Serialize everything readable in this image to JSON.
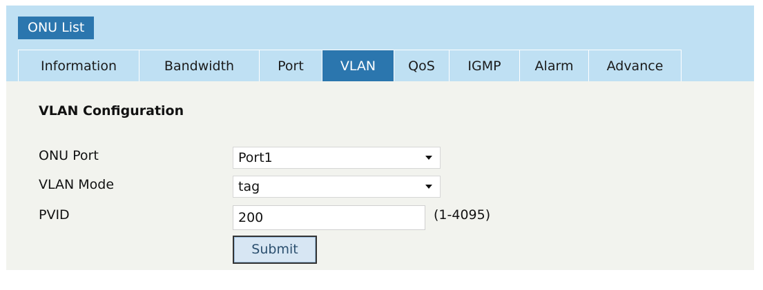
{
  "header": {
    "section_tab_label": "ONU List"
  },
  "tabs": [
    {
      "label": "Information",
      "active": false
    },
    {
      "label": "Bandwidth",
      "active": false
    },
    {
      "label": "Port",
      "active": false
    },
    {
      "label": "VLAN",
      "active": true
    },
    {
      "label": "QoS",
      "active": false
    },
    {
      "label": "IGMP",
      "active": false
    },
    {
      "label": "Alarm",
      "active": false
    },
    {
      "label": "Advance",
      "active": false
    }
  ],
  "form": {
    "title": "VLAN Configuration",
    "onu_port": {
      "label": "ONU Port",
      "value": "Port1"
    },
    "vlan_mode": {
      "label": "VLAN Mode",
      "value": "tag"
    },
    "pvid": {
      "label": "PVID",
      "value": "200",
      "range_hint": "(1-4095)"
    },
    "submit_label": "Submit"
  },
  "colors": {
    "header_band": "#bfe0f3",
    "active_tab": "#2b76ae",
    "content_background": "#f2f3ee"
  },
  "icons": {
    "dropdown": "chevron-down-icon"
  }
}
